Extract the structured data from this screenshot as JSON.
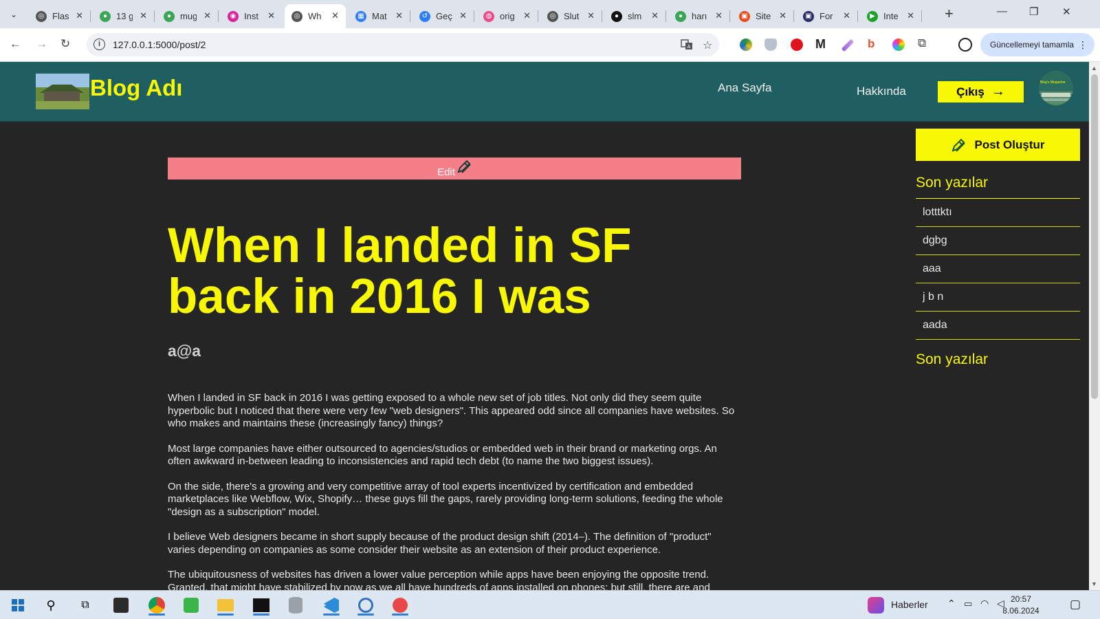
{
  "browser": {
    "tabs": [
      {
        "title": "Flas",
        "color": "#555555",
        "glyph": "◎"
      },
      {
        "title": "13 g",
        "color": "#3aa655",
        "glyph": "●"
      },
      {
        "title": "mug",
        "color": "#3aa655",
        "glyph": "●"
      },
      {
        "title": "Inst",
        "color": "#d6249f",
        "glyph": "◉"
      },
      {
        "title": "Wh",
        "color": "#555555",
        "glyph": "◎"
      },
      {
        "title": "Mat",
        "color": "#2f7cf6",
        "glyph": "▦"
      },
      {
        "title": "Geç",
        "color": "#2f7cf6",
        "glyph": "↺"
      },
      {
        "title": "orig",
        "color": "#ea4c89",
        "glyph": "◍"
      },
      {
        "title": "Slut",
        "color": "#555555",
        "glyph": "◎"
      },
      {
        "title": "slm",
        "color": "#111111",
        "glyph": "●"
      },
      {
        "title": "harı",
        "color": "#3aa655",
        "glyph": "●"
      },
      {
        "title": "Site",
        "color": "#e94b1e",
        "glyph": "▣"
      },
      {
        "title": "For",
        "color": "#2b2b6b",
        "glyph": "▣"
      },
      {
        "title": "Inte",
        "color": "#1da12a",
        "glyph": "▶"
      }
    ],
    "active_tab_index": 4,
    "new_tab": "+",
    "window_controls": {
      "minimize": "—",
      "restore": "❐",
      "close": "✕"
    },
    "url": "127.0.0.1:5000/post/2",
    "update_button": "Güncellemeyi tamamla",
    "update_menu": "⋮"
  },
  "nav": {
    "brand": "Blog Adı",
    "links": {
      "home": "Ana Sayfa",
      "about": "Hakkında"
    },
    "logout": "Çıkış",
    "logout_arrow": "→",
    "avatar_caption": "Blog's Megazine"
  },
  "post": {
    "edit_label": "Edit",
    "title": "When I landed in SF back in 2016 I was",
    "author": "a@a",
    "paragraphs": [
      "When I landed in SF back in 2016 I was getting exposed to a whole new set of job titles. Not only did they seem quite hyperbolic but I noticed that there were very few \"web designers\". This appeared odd since all companies have websites. So who makes and maintains these (increasingly fancy) things?",
      "Most large companies have either outsourced to agencies/studios or embedded web in their brand or marketing orgs. An often awkward in-between leading to inconsistencies and rapid tech debt (to name the two biggest issues).",
      "On the side, there's a growing and very competitive array of tool experts incentivized by certification and embedded marketplaces like Webflow, Wix, Shopify… these guys fill the gaps, rarely providing long-term solutions, feeding the whole \"design as a subscription\" model.",
      "I believe Web designers became in short supply because of the product design shift (2014–). The definition of \"product\" varies depending on companies as some consider their website as an extension of their product experience.",
      "The ubiquitousness of websites has driven a lower value perception while apps have been enjoying the opposite trend. Granted, that might have stabilized by now as we all have hundreds of apps installed on phones; but still, there are and"
    ]
  },
  "sidebar": {
    "create_button": "Post Oluştur",
    "recent_heading": "Son yazılar",
    "recent_posts": [
      "lotttktı",
      "dgbg",
      "aaa",
      "j b n",
      "aada"
    ],
    "second_heading": "Son yazılar"
  },
  "taskbar": {
    "news": "Haberler",
    "time": "20:57",
    "date": "8.06.2024"
  },
  "colors": {
    "nav_bg": "#1f5f62",
    "accent_yellow": "#f7f706",
    "edit_bar": "#f47f89",
    "page_bg": "#252525"
  }
}
